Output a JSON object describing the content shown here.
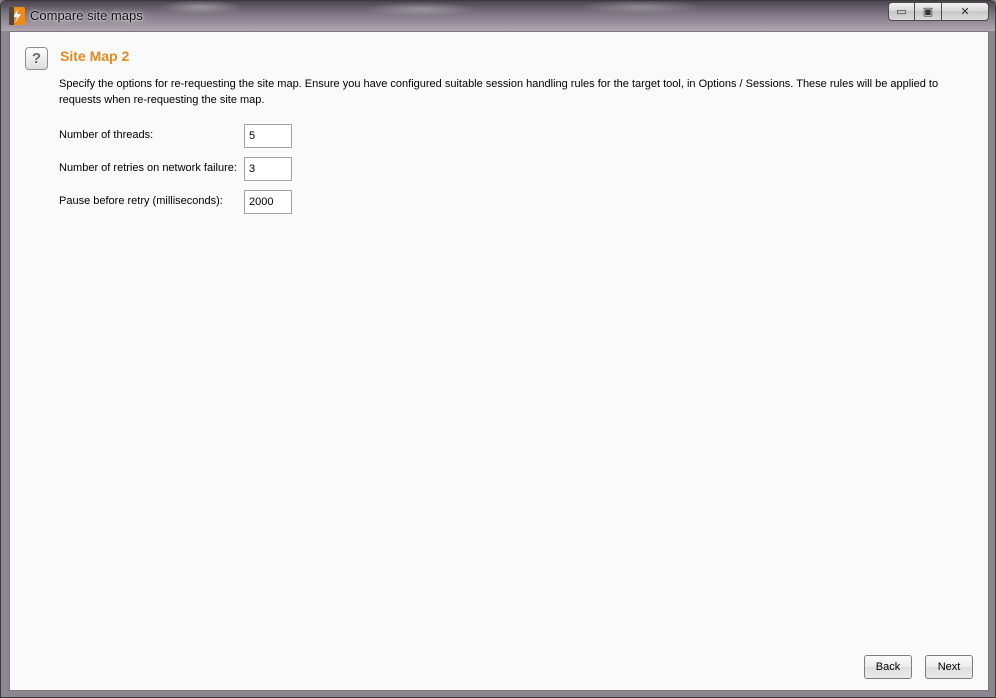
{
  "window": {
    "title": "Compare site maps",
    "controls": {
      "minimize": "▭",
      "maximize": "▣",
      "close": "✕"
    }
  },
  "page": {
    "help_glyph": "?",
    "title": "Site Map 2",
    "description": "Specify the options for re-requesting the site map. Ensure you have configured suitable session handling rules for the target tool, in Options / Sessions. These rules will be applied to requests when re-requesting the site map."
  },
  "form": {
    "threads": {
      "label": "Number of threads:",
      "value": "5"
    },
    "retries": {
      "label": "Number of retries on network failure:",
      "value": "3"
    },
    "pause": {
      "label": "Pause before retry (milliseconds):",
      "value": "2000"
    }
  },
  "buttons": {
    "back": "Back",
    "next": "Next"
  },
  "colors": {
    "accent": "#e58a1f",
    "background": "#fafafa"
  }
}
